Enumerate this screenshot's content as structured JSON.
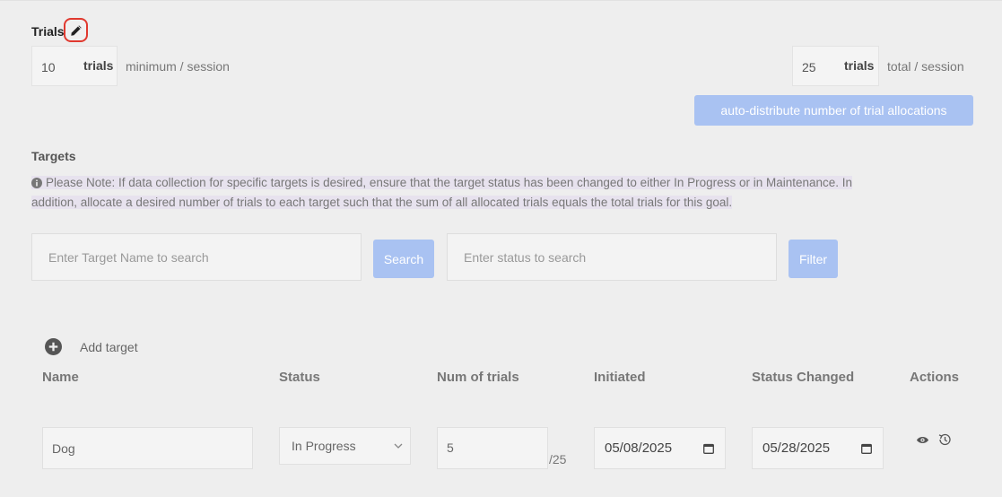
{
  "trials": {
    "title": "Trials",
    "min_value": "10",
    "min_unit": "trials",
    "min_suffix": "minimum / session",
    "total_value": "25",
    "total_unit": "trials",
    "total_suffix": "total / session",
    "auto_distribute_label": "auto-distribute number of trial allocations"
  },
  "targets": {
    "title": "Targets",
    "note_line1": "Please Note: If data collection for specific targets is desired, ensure that the target status has been changed to either In Progress or in Maintenance. In",
    "note_line2": "addition, allocate a desired number of trials to each target such that the sum of all allocated trials equals the total trials for this goal.",
    "name_search_placeholder": "Enter Target Name to search",
    "search_label": "Search",
    "status_search_placeholder": "Enter status to search",
    "filter_label": "Filter",
    "add_target_label": "Add target"
  },
  "table": {
    "headers": [
      "Name",
      "Status",
      "Num of trials",
      "Initiated",
      "Status Changed",
      "Actions"
    ],
    "rows": [
      {
        "name": "Dog",
        "status": "In Progress",
        "num_trials": "5",
        "num_suffix": "/25",
        "initiated": "05/08/2025",
        "status_changed": "05/28/2025"
      }
    ]
  },
  "colors": {
    "accent_button": "#a9c2f2",
    "highlight_ring": "#e0392f",
    "note_highlight": "#e7e2ee"
  }
}
